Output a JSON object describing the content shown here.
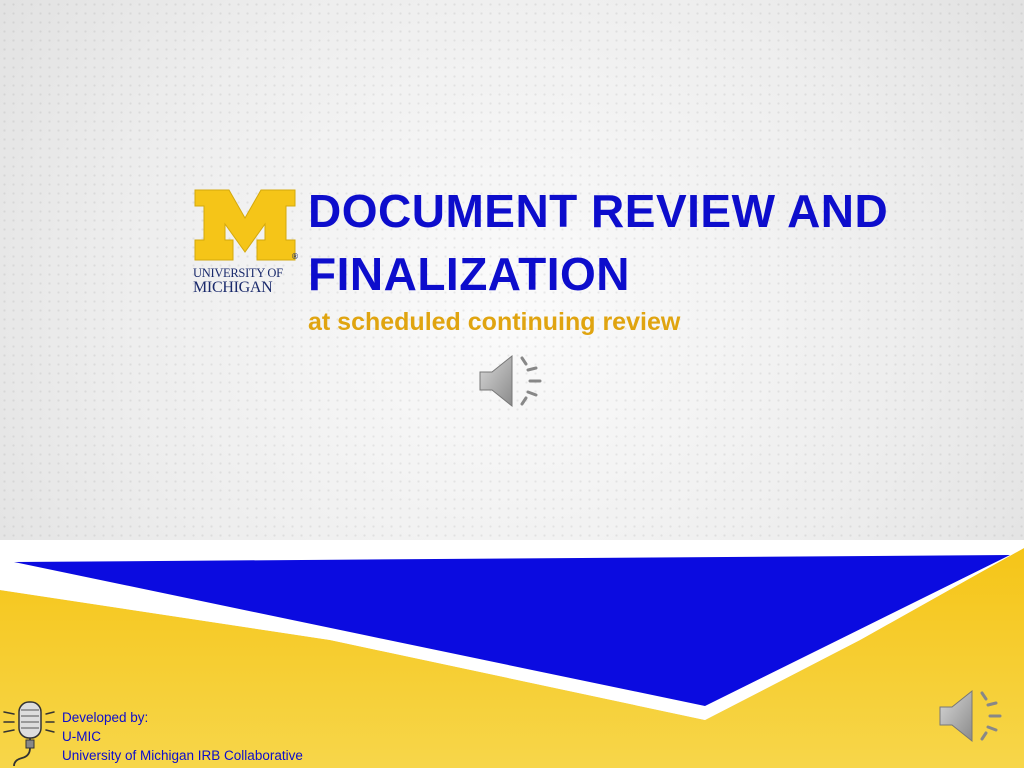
{
  "slide": {
    "title": "Document Review and Finalization",
    "subtitle": "at scheduled continuing review"
  },
  "logo": {
    "letter": "M",
    "line1": "UNIVERSITY OF",
    "line2": "MICHIGAN",
    "trademark": "®"
  },
  "credits": {
    "line1": "Developed by:",
    "line2": "U-MIC",
    "line3": "University of Michigan IRB Collaborative"
  },
  "icons": {
    "center_audio": "speaker-icon",
    "corner_audio": "speaker-icon",
    "microphone": "microphone-icon"
  },
  "colors": {
    "title_blue": "#0d0dcc",
    "subtitle_gold": "#e0a410",
    "maize": "#f5c518",
    "band_blue": "#0b0be0",
    "michigan_navy": "#1a2a6c"
  }
}
